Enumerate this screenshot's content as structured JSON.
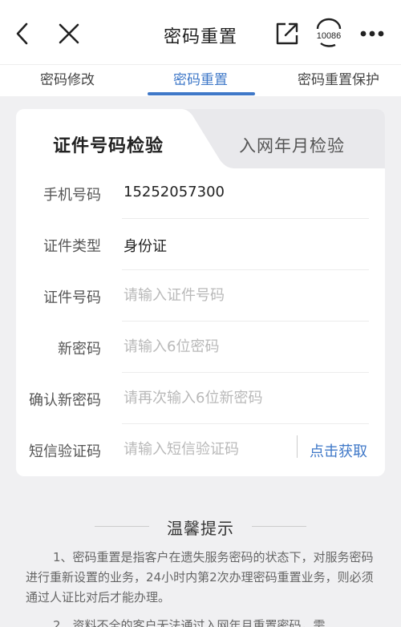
{
  "header": {
    "title": "密码重置",
    "icons": [
      "back-icon",
      "close-icon",
      "share-icon",
      "customer-service-icon",
      "more-icon"
    ],
    "service_label": "10086"
  },
  "tabs": [
    {
      "label": "密码修改",
      "active": false
    },
    {
      "label": "密码重置",
      "active": true
    },
    {
      "label": "密码重置保护",
      "active": false
    }
  ],
  "subtabs": {
    "active": "证件号码检验",
    "inactive": "入网年月检验"
  },
  "form": {
    "phone_label": "手机号码",
    "phone_value": "15252057300",
    "id_type_label": "证件类型",
    "id_type_value": "身份证",
    "id_number_label": "证件号码",
    "id_number_placeholder": "请输入证件号码",
    "new_password_label": "新密码",
    "new_password_placeholder": "请输入6位密码",
    "confirm_password_label": "确认新密码",
    "confirm_password_placeholder": "请再次输入6位新密码",
    "sms_label": "短信验证码",
    "sms_placeholder": "请输入短信验证码",
    "sms_button": "点击获取"
  },
  "tips": {
    "title": "温馨提示",
    "item1": "1、密码重置是指客户在遗失服务密码的状态下，对服务密码进行重新设置的业务，24小时内第2次办理密码重置业务，则必须通过人证比对后才能办理。",
    "item2": "2、资料不全的客户无法通过入网年月重置密码，需"
  },
  "colors": {
    "accent": "#3f78c8",
    "background": "#f0f0f2"
  }
}
